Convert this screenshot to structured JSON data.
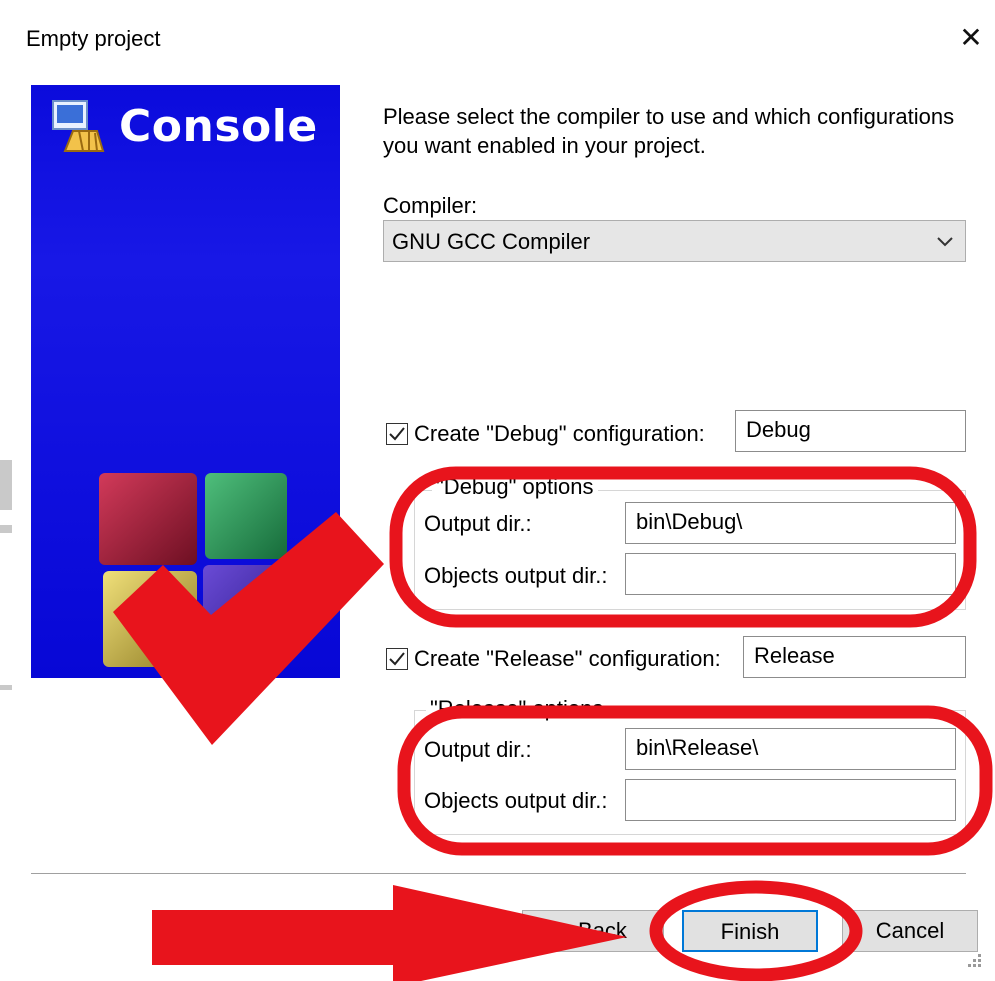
{
  "dialog": {
    "title": "Empty project",
    "close_icon": "close-icon"
  },
  "banner": {
    "title": "Console",
    "icon": "console-app-icon",
    "colors": {
      "background": "#0b0bdc",
      "text": "#ffffff"
    }
  },
  "main": {
    "instructions": "Please select the compiler to use and which configurations you want enabled in your project.",
    "instructions_line1": "Please select the compiler to use and which configurations",
    "instructions_line2": "you want enabled in your project.",
    "compiler_label": "Compiler:",
    "compiler_value": "GNU GCC Compiler",
    "debug": {
      "checkbox_label": "Create \"Debug\" configuration:",
      "checked": true,
      "name_value": "Debug",
      "group_title": "\"Debug\" options",
      "output_dir_label": "Output dir.:",
      "output_dir_value": "bin\\Debug\\",
      "objects_dir_label": "Objects output dir.:",
      "objects_dir_value": ""
    },
    "release": {
      "checkbox_label": "Create \"Release\" configuration:",
      "checked": true,
      "name_value": "Release",
      "group_title": "\"Release\" options",
      "output_dir_label": "Output dir.:",
      "output_dir_value": "bin\\Release\\",
      "objects_dir_label": "Objects output dir.:",
      "objects_dir_value": ""
    }
  },
  "buttons": {
    "back": "< Back",
    "finish": "Finish",
    "cancel": "Cancel"
  },
  "annotations": {
    "color": "#e8141c",
    "items": [
      "checkmark",
      "debug-options-circle",
      "release-options-circle",
      "finish-circle",
      "arrow-to-finish"
    ]
  }
}
